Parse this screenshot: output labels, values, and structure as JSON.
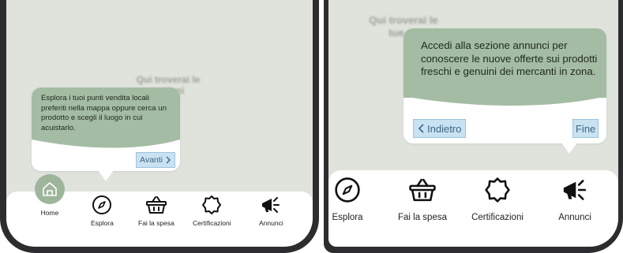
{
  "left_screen": {
    "background_text": "Qui troverai le\nsezioni",
    "tooltip": {
      "message": "Esplora i tuoi punti vendita locali preferiti nella mappa oppure cerca un prodotto e scegli il luogo in cui acuistarlo.",
      "next_label": "Avanti"
    },
    "nav": {
      "home": "Home",
      "explore": "Esplora",
      "shopping": "Fai la spesa",
      "certifications": "Certificazioni",
      "ads": "Annunci"
    }
  },
  "right_screen": {
    "background_text": "Qui troverai le\ntue ce",
    "tooltip": {
      "message": "Accedi alla sezione annunci per conoscere le nuove offerte sui prodotti freschi e genuini dei mercanti in zona.",
      "back_label": "Indietro",
      "finish_label": "Fine"
    },
    "nav": {
      "explore": "Esplora",
      "shopping": "Fai la spesa",
      "certifications": "Certificazioni",
      "ads": "Annunci"
    }
  },
  "colors": {
    "screen_bg": "#dfe3dc",
    "tooltip_green": "#a4bca3",
    "button_bg": "#c9e2f1",
    "frame": "#2d2d30"
  },
  "icons": [
    "home-icon",
    "compass-icon",
    "basket-icon",
    "badge-icon",
    "megaphone-icon",
    "chevron-right-icon",
    "chevron-left-icon"
  ]
}
